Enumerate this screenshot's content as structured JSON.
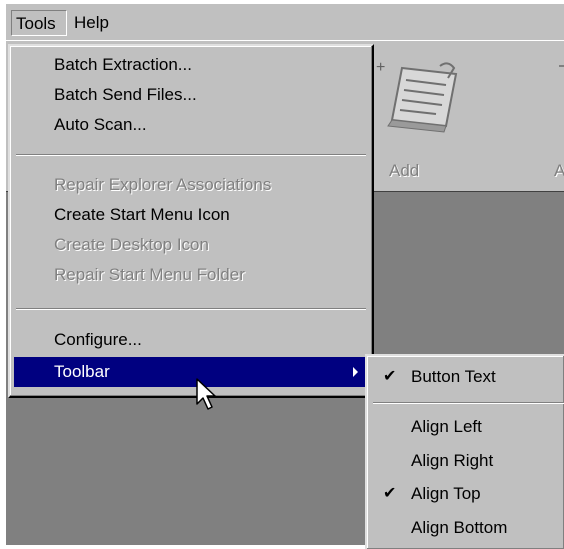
{
  "menubar": {
    "tools": "Tools",
    "help": "Help"
  },
  "toolbar": {
    "add_label": "Add",
    "next_label": "A"
  },
  "tools_menu": {
    "items": [
      {
        "label": "Batch Extraction...",
        "enabled": true
      },
      {
        "label": "Batch Send Files...",
        "enabled": true
      },
      {
        "label": "Auto Scan...",
        "enabled": true
      },
      {
        "label": "Repair Explorer Associations",
        "enabled": false
      },
      {
        "label": "Create Start Menu Icon",
        "enabled": true
      },
      {
        "label": "Create Desktop Icon",
        "enabled": false
      },
      {
        "label": "Repair Start Menu Folder",
        "enabled": false
      },
      {
        "label": "Configure...",
        "enabled": true
      },
      {
        "label": "Toolbar",
        "enabled": true,
        "selected": true,
        "has_submenu": true
      }
    ]
  },
  "toolbar_submenu": {
    "items": [
      {
        "label": "Button Text",
        "checked": true
      },
      {
        "label": "Align Left",
        "checked": false
      },
      {
        "label": "Align Right",
        "checked": false
      },
      {
        "label": "Align Top",
        "checked": true
      },
      {
        "label": "Align Bottom",
        "checked": false
      }
    ]
  },
  "colors": {
    "menu_face": "#c0c0c0",
    "highlight": "#000080",
    "workspace": "#808080",
    "disabled_text": "#808080"
  },
  "icons": {
    "check": "checkmark-icon",
    "submenu": "submenu-arrow-icon",
    "cursor": "mouse-pointer-icon",
    "add": "add-document-icon"
  }
}
